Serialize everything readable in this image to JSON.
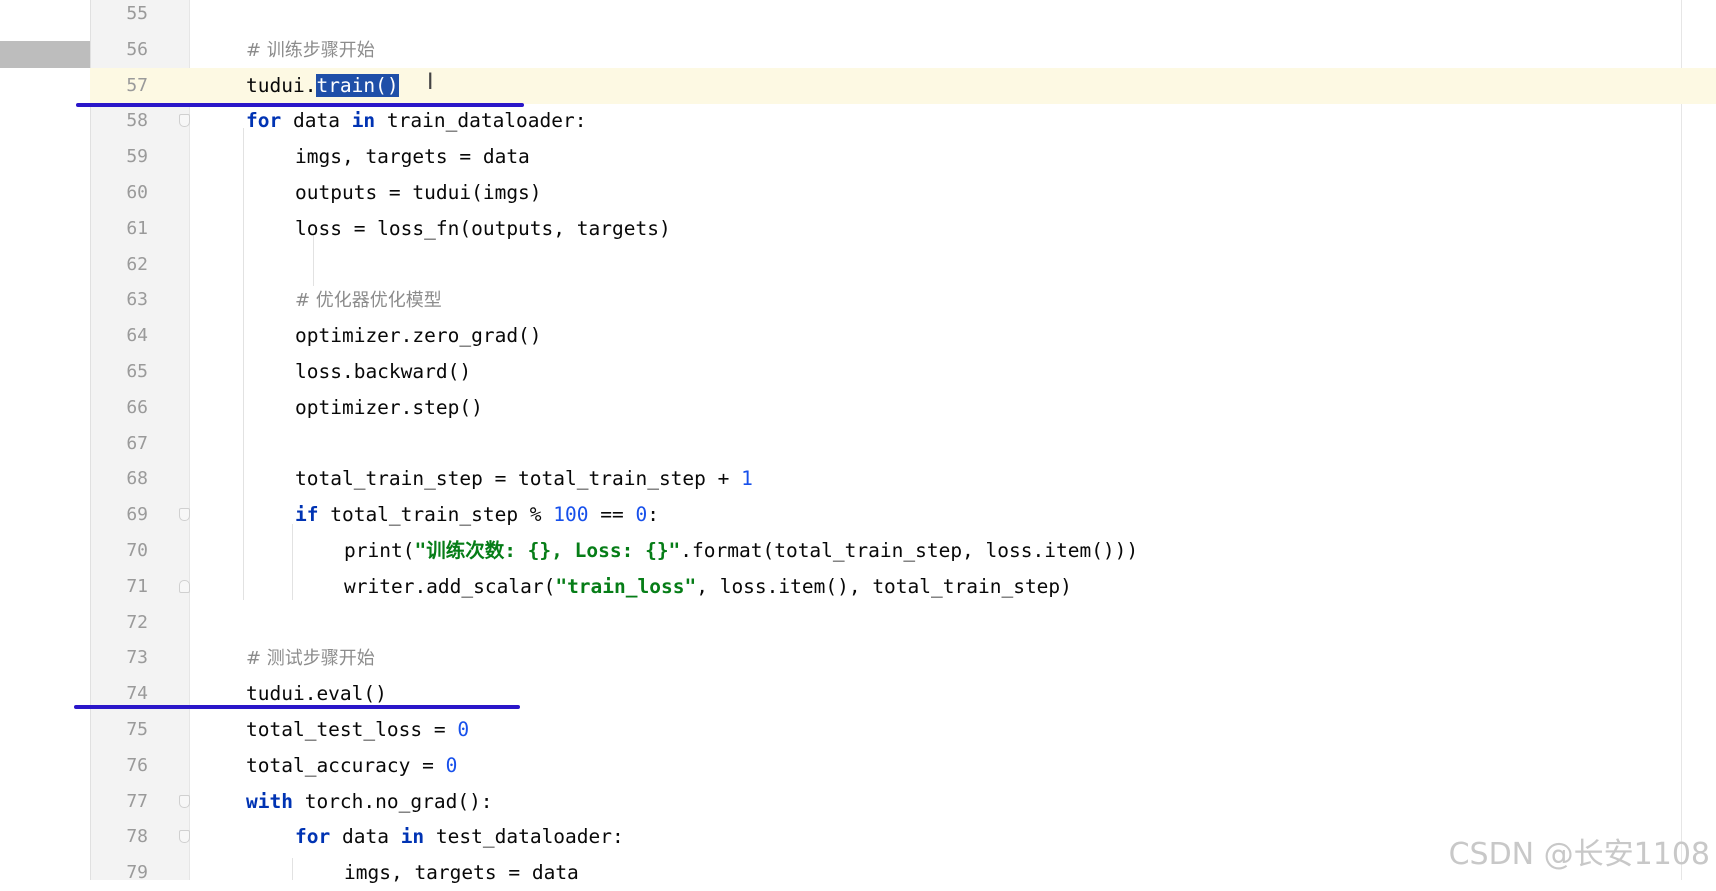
{
  "editor": {
    "lines": [
      {
        "num": "55",
        "segments": []
      },
      {
        "num": "56",
        "segments": [
          {
            "t": "# 训练步骤开始",
            "c": "comment"
          }
        ]
      },
      {
        "num": "57",
        "segments": [
          {
            "t": "tudui.",
            "c": ""
          },
          {
            "t": "train()",
            "c": "sel"
          }
        ]
      },
      {
        "num": "58",
        "segments": [
          {
            "t": "for",
            "c": "kw"
          },
          {
            "t": " data ",
            "c": ""
          },
          {
            "t": "in",
            "c": "kw"
          },
          {
            "t": " train_dataloader:",
            "c": ""
          }
        ]
      },
      {
        "num": "59",
        "segments": [
          {
            "t": "imgs, targets = data",
            "c": ""
          }
        ]
      },
      {
        "num": "60",
        "segments": [
          {
            "t": "outputs = tudui(imgs)",
            "c": ""
          }
        ]
      },
      {
        "num": "61",
        "segments": [
          {
            "t": "loss = loss_fn(outputs, targets)",
            "c": ""
          }
        ]
      },
      {
        "num": "62",
        "segments": []
      },
      {
        "num": "63",
        "segments": [
          {
            "t": "# 优化器优化模型",
            "c": "comment"
          }
        ]
      },
      {
        "num": "64",
        "segments": [
          {
            "t": "optimizer.zero_grad()",
            "c": ""
          }
        ]
      },
      {
        "num": "65",
        "segments": [
          {
            "t": "loss.backward()",
            "c": ""
          }
        ]
      },
      {
        "num": "66",
        "segments": [
          {
            "t": "optimizer.step()",
            "c": ""
          }
        ]
      },
      {
        "num": "67",
        "segments": []
      },
      {
        "num": "68",
        "segments": [
          {
            "t": "total_train_step = total_train_step + ",
            "c": ""
          },
          {
            "t": "1",
            "c": "num"
          }
        ]
      },
      {
        "num": "69",
        "segments": [
          {
            "t": "if",
            "c": "kw"
          },
          {
            "t": " total_train_step % ",
            "c": ""
          },
          {
            "t": "100",
            "c": "num"
          },
          {
            "t": " == ",
            "c": ""
          },
          {
            "t": "0",
            "c": "num"
          },
          {
            "t": ":",
            "c": ""
          }
        ]
      },
      {
        "num": "70",
        "segments": [
          {
            "t": "print(",
            "c": ""
          },
          {
            "t": "\"训练次数: {}, Loss: {}\"",
            "c": "str"
          },
          {
            "t": ".format(total_train_step, loss.item()))",
            "c": ""
          }
        ]
      },
      {
        "num": "71",
        "segments": [
          {
            "t": "writer.add_scalar(",
            "c": ""
          },
          {
            "t": "\"train_loss\"",
            "c": "str"
          },
          {
            "t": ", loss.item(), total_train_step)",
            "c": ""
          }
        ]
      },
      {
        "num": "72",
        "segments": []
      },
      {
        "num": "73",
        "segments": [
          {
            "t": "# 测试步骤开始",
            "c": "comment"
          }
        ]
      },
      {
        "num": "74",
        "segments": [
          {
            "t": "tudui.eval()",
            "c": ""
          }
        ]
      },
      {
        "num": "75",
        "segments": [
          {
            "t": "total_test_loss = ",
            "c": ""
          },
          {
            "t": "0",
            "c": "num"
          }
        ]
      },
      {
        "num": "76",
        "segments": [
          {
            "t": "total_accuracy = ",
            "c": ""
          },
          {
            "t": "0",
            "c": "num"
          }
        ]
      },
      {
        "num": "77",
        "segments": [
          {
            "t": "with",
            "c": "kw"
          },
          {
            "t": " torch.no_grad():",
            "c": ""
          }
        ]
      },
      {
        "num": "78",
        "segments": [
          {
            "t": "for",
            "c": "kw"
          },
          {
            "t": " data ",
            "c": ""
          },
          {
            "t": "in",
            "c": "kw"
          },
          {
            "t": " test_dataloader:",
            "c": ""
          }
        ]
      },
      {
        "num": "79",
        "segments": [
          {
            "t": "imgs, targets = data",
            "c": ""
          }
        ]
      }
    ],
    "current_line": "57",
    "cursor_glyph": "I",
    "syntax_colors": {
      "keyword": "#0033b3",
      "number": "#1750eb",
      "string": "#067d17",
      "comment": "#8c8c8c",
      "selection": "#1f4fa8",
      "current_line_bg": "#fdf9e3",
      "annotation": "#2a16c9"
    }
  },
  "watermark": "CSDN @长安1108"
}
